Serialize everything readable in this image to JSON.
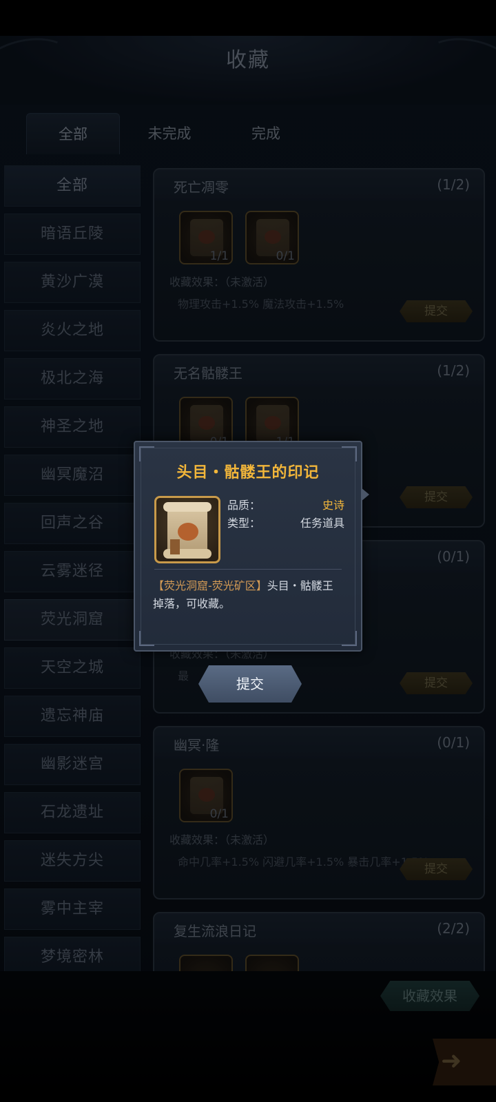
{
  "title": "收藏",
  "tabs": [
    "全部",
    "未完成",
    "完成"
  ],
  "sidebar": [
    "全部",
    "暗语丘陵",
    "黄沙广漠",
    "炎火之地",
    "极北之海",
    "神圣之地",
    "幽冥魔沼",
    "回声之谷",
    "云雾迷径",
    "荧光洞窟",
    "天空之城",
    "遗忘神庙",
    "幽影迷宫",
    "石龙遗址",
    "迷失方尖",
    "雾中主宰",
    "梦境密林"
  ],
  "cards": [
    {
      "name": "死亡凋零",
      "count": "(1/2)",
      "items": [
        "1/1",
        "0/1"
      ],
      "effect_label": "收藏效果：（未激活）",
      "effect_stats": "物理攻击+1.5%  魔法攻击+1.5%",
      "submit": "提交"
    },
    {
      "name": "无名骷髅王",
      "count": "(1/2)",
      "items": [
        "0/1",
        "1/1"
      ],
      "effect_label": "",
      "effect_stats": "",
      "submit": "提交"
    },
    {
      "name": "",
      "count": "(0/1)",
      "items": [],
      "effect_label": "收藏效果：（未激活）",
      "effect_stats": "最",
      "submit": "提交"
    },
    {
      "name": "幽冥·隆",
      "count": "(0/1)",
      "items": [
        "0/1"
      ],
      "effect_label": "收藏效果：（未激活）",
      "effect_stats": "命中几率+1.5%  闪避几率+1.5%  暴击几率+1.5%",
      "submit": "提交"
    },
    {
      "name": "复生流浪日记",
      "count": "(2/2)",
      "items": [
        "",
        ""
      ],
      "effect_label": "",
      "effect_stats": "",
      "submit": ""
    }
  ],
  "collection_effect_button": "收藏效果",
  "popup": {
    "title": "头目・骷髅王的印记",
    "quality_label": "品质：",
    "quality_value": "史诗",
    "type_label": "类型：",
    "type_value": "任务道具",
    "desc_location": "【荧光洞窟-荧光矿区】",
    "desc_text": "头目・骷髅王 掉落，可收藏。",
    "submit": "提交"
  },
  "colors": {
    "epic": "#f2b63a",
    "location": "#d49b55"
  }
}
